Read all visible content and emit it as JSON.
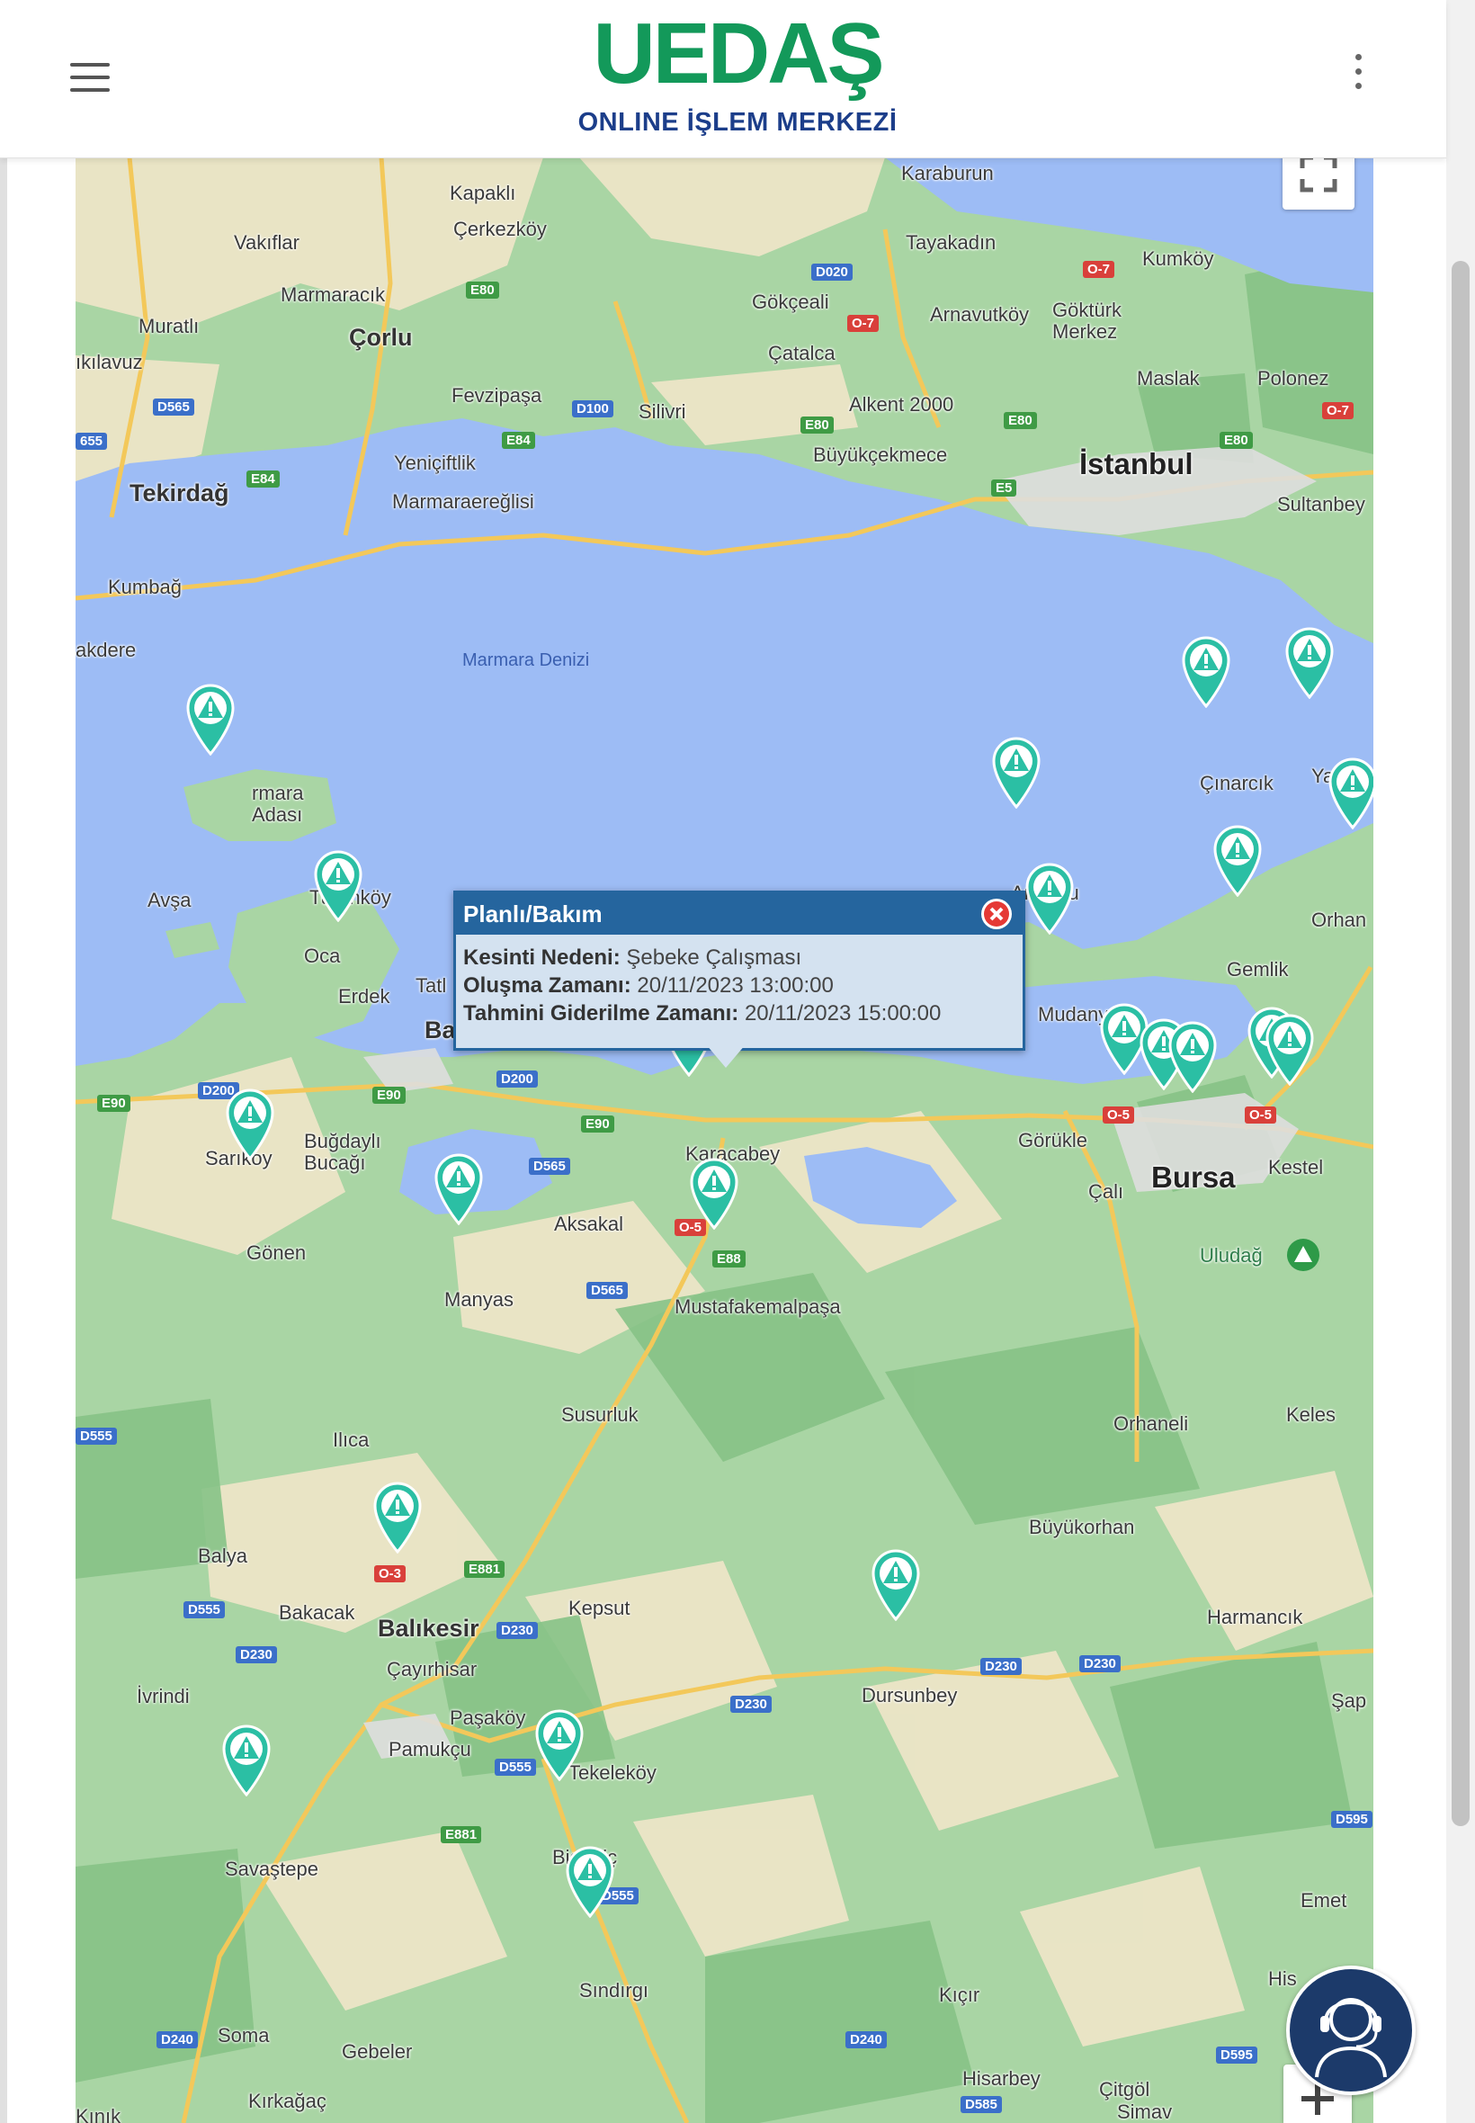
{
  "header": {
    "brand": "UEDAŞ",
    "subtitle": "ONLINE İŞLEM MERKEZİ",
    "menu_icon": "hamburger-menu-icon",
    "more_icon": "more-vert-icon",
    "brand_color": "#13995a",
    "subtitle_color": "#1c3e8a"
  },
  "map": {
    "sea_label": "Marmara Denizi",
    "places": {
      "karaburun": "Karaburun",
      "kapakli": "Kapaklı",
      "cerkezkoy": "Çerkezköy",
      "vakiflar": "Vakıflar",
      "marmaracik": "Marmaracık",
      "corlu": "Çorlu",
      "muratli": "Muratlı",
      "kilavuz": "ıkılavuz",
      "gokceali": "Gökçeali",
      "tayakadin": "Tayakadın",
      "kumkoy": "Kumköy",
      "arnavutkoy": "Arnavutköy",
      "gokturk": "Göktürk Merkez",
      "catalca": "Çatalca",
      "maslak": "Maslak",
      "polonez": "Polonez",
      "fevzipasa": "Fevzipaşa",
      "silivri": "Silivri",
      "alkent": "Alkent 2000",
      "buyukcekmece": "Büyükçekmece",
      "istanbul": "İstanbul",
      "sultanbey": "Sultanbey",
      "tekirdag": "Tekirdağ",
      "yeniciftlik": "Yeniçiftlik",
      "marmaraereglisi": "Marmaraereğlisi",
      "kumbag": "Kumbağ",
      "akdere": "akdere",
      "marmara_adasi": "rmara Adası",
      "cinarcik": "Çınarcık",
      "yalova": "Yalova",
      "armutlu": "Armutlu",
      "orhangazi": "Orhan",
      "gemlik": "Gemlik",
      "mudanya": "Mudanya",
      "avsa": "Avşa",
      "turankoy": "Turanköy",
      "ocakli": "Oca",
      "erdek": "Erdek",
      "tatlisu": "Tatl",
      "bandirma": "Bandırma",
      "karacabey": "Karacabey",
      "gorukle": "Görükle",
      "cali": "Çalı",
      "bursa": "Bursa",
      "kestel": "Kestel",
      "uludag": "Uludağ",
      "sarikoy": "Sarıkoy",
      "bugdayli": "Buğdaylı Bucağı",
      "gonen": "Gönen",
      "aksakal": "Aksakal",
      "manyas": "Manyas",
      "mustafakemalpasa": "Mustafakemalpaşa",
      "susurluk": "Susurluk",
      "orhaneli": "Orhaneli",
      "keles": "Keles",
      "ilica": "Ilıca",
      "balya": "Balya",
      "buyukorhan": "Büyükorhan",
      "bakacak": "Bakacak",
      "balikesir": "Balıkesir",
      "kepsut": "Kepsut",
      "harmancik": "Harmancık",
      "cayirhisar": "Çayırhisar",
      "ivrindi": "İvrindi",
      "dursunbey": "Dursunbey",
      "sap": "Şap",
      "pasakoy": "Paşaköy",
      "pamukcu": "Pamukçu",
      "tekelekoy": "Tekeleköy",
      "bigadic": "Bigadiç",
      "savastepe": "Savaştepe",
      "emet": "Emet",
      "sindirgi": "Sındırgı",
      "kicir": "Kıçır",
      "his": "His",
      "soma": "Soma",
      "gebeler": "Gebeler",
      "hisarbey": "Hisarbey",
      "citgol": "Çitgöl",
      "kirkagac": "Kırkağaç",
      "kinik": "Kınık",
      "simav": "Simav"
    },
    "roads": {
      "d020": "D020",
      "o7a": "O-7",
      "o7b": "O-7",
      "o7c": "O-7",
      "e80a": "E80",
      "e80b": "E80",
      "e80c": "E80",
      "e80d": "E80",
      "d565": "D565",
      "d100": "D100",
      "e84": "E84",
      "e5": "E5",
      "e84b": "E84",
      "d655": "655",
      "e90a": "E90",
      "d200a": "D200",
      "e90b": "E90",
      "d200b": "D200",
      "e90c": "E90",
      "d565b": "D565",
      "o5": "O-5",
      "e881": "E88",
      "d565c": "D565",
      "o5b": "O-5",
      "d555": "D555",
      "e881b": "E881",
      "o3": "O-3",
      "d230a": "D230",
      "d230b": "D230",
      "d230c": "D230",
      "d230d": "D230",
      "d230e": "D230",
      "d555b": "D555",
      "d555c": "D555",
      "e881c": "E881",
      "d595": "D595",
      "d240a": "D240",
      "d240b": "D240",
      "d595b": "D595",
      "d585": "D585",
      "o5c": "O-5",
      "d555d": "D555"
    },
    "pin_icon": "outage-warning-pin-icon",
    "pin_color": "#2bbfa4",
    "popup": {
      "title": "Planlı/Bakım",
      "reason_label": "Kesinti Nedeni:",
      "reason_value": "Şebeke Çalışması",
      "created_label": "Oluşma Zamanı:",
      "created_value": "20/11/2023 13:00:00",
      "eta_label": "Tahmini Giderilme Zamanı:",
      "eta_value": "20/11/2023 15:00:00",
      "close_icon": "close-icon",
      "header_color": "#25659e"
    },
    "controls": {
      "fullscreen_icon": "fullscreen-icon",
      "zoom_in_icon": "plus-icon",
      "support_icon": "customer-support-agent-icon"
    }
  }
}
